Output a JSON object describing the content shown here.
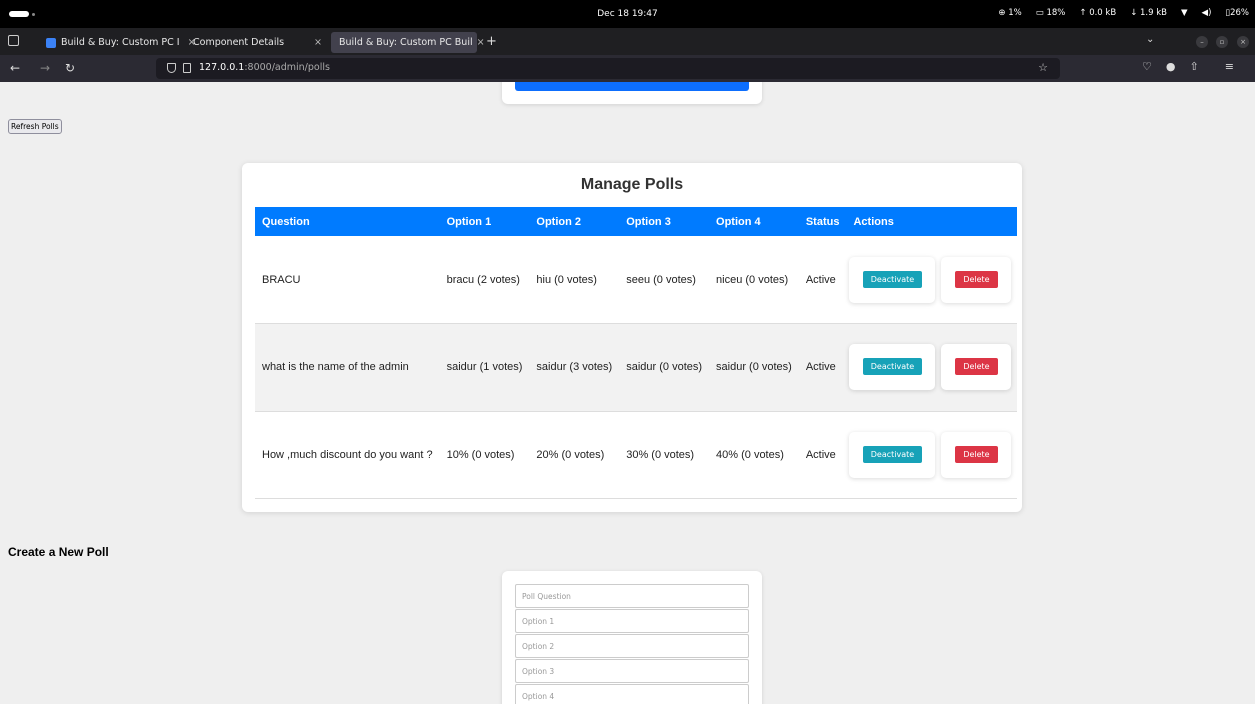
{
  "system": {
    "clock": "Dec 18 19:47",
    "tray": [
      "1%",
      "18%",
      "↑ 0.0 kB",
      "↓ 1.9 kB",
      "26%"
    ]
  },
  "browser": {
    "tabs": [
      {
        "label": "Build & Buy: Custom PC I",
        "active": false
      },
      {
        "label": "Component Details",
        "active": false
      },
      {
        "label": "Build & Buy: Custom PC Buil",
        "active": true
      }
    ],
    "url_host": "127.0.0.1",
    "url_path": ":8000/admin/polls"
  },
  "page": {
    "refresh_label": "Refresh Polls",
    "manage_title": "Manage Polls",
    "columns": [
      "Question",
      "Option 1",
      "Option 2",
      "Option 3",
      "Option 4",
      "Status",
      "Actions"
    ],
    "polls": [
      {
        "question": "BRACU",
        "opt1": "bracu (2 votes)",
        "opt2": "hiu (0 votes)",
        "opt3": "seeu (0 votes)",
        "opt4": "niceu (0 votes)",
        "status": "Active"
      },
      {
        "question": "what is the name of the admin",
        "opt1": "saidur (1 votes)",
        "opt2": "saidur (3 votes)",
        "opt3": "saidur (0 votes)",
        "opt4": "saidur (0 votes)",
        "status": "Active"
      },
      {
        "question": "How ,much discount do you want ?",
        "opt1": "10% (0 votes)",
        "opt2": "20% (0 votes)",
        "opt3": "30% (0 votes)",
        "opt4": "40% (0 votes)",
        "status": "Active"
      }
    ],
    "deactivate_label": "Deactivate",
    "delete_label": "Delete",
    "create_title": "Create a New Poll",
    "form": {
      "question_placeholder": "Poll Question",
      "option1_placeholder": "Option 1",
      "option2_placeholder": "Option 2",
      "option3_placeholder": "Option 3",
      "option4_placeholder": "Option 4"
    }
  }
}
